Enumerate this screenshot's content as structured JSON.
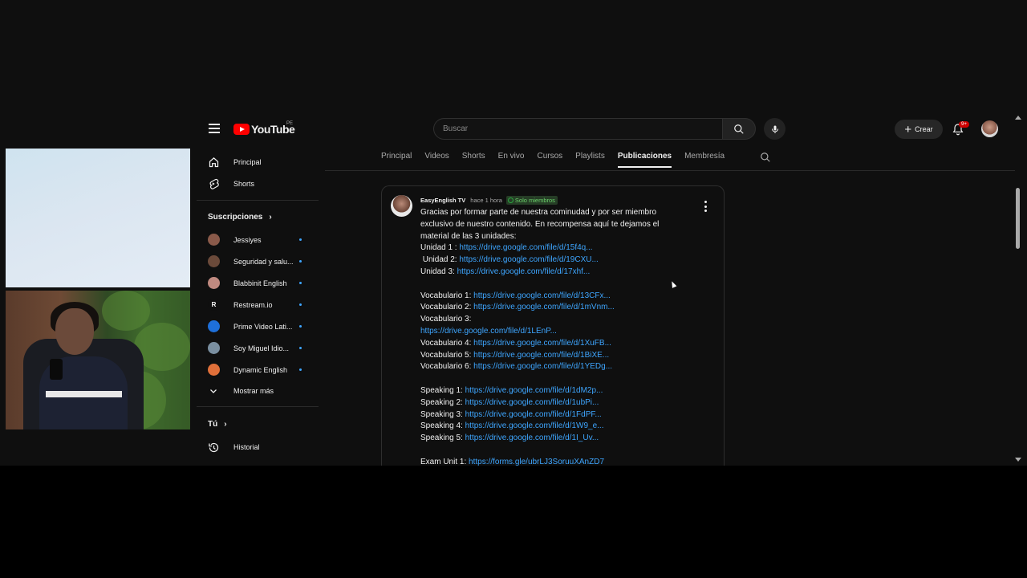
{
  "header": {
    "logo_text": "YouTube",
    "region": "PE",
    "search_placeholder": "Buscar",
    "create_label": "Crear",
    "notifications_badge": "9+"
  },
  "sidebar": {
    "main_items": [
      {
        "label": "Principal",
        "icon": "home-icon"
      },
      {
        "label": "Shorts",
        "icon": "shorts-icon"
      }
    ],
    "subscriptions_title": "Suscripciones",
    "subscriptions": [
      {
        "label": "Jessiyes",
        "avatar_color": "#8a5a4a"
      },
      {
        "label": "Seguridad y salu...",
        "avatar_color": "#6b4a3a"
      },
      {
        "label": "Blabbinit English",
        "avatar_color": "#c08a80"
      },
      {
        "label": "Restream.io",
        "avatar_color": "#0f0f0f",
        "letter": "R"
      },
      {
        "label": "Prime Video Lati...",
        "avatar_color": "#1e6fd9"
      },
      {
        "label": "Soy Miguel Idio...",
        "avatar_color": "#7a8fa0"
      },
      {
        "label": "Dynamic English",
        "avatar_color": "#e0703a"
      }
    ],
    "show_more": "Mostrar más",
    "you_title": "Tú",
    "history": "Historial"
  },
  "tabs": [
    "Principal",
    "Videos",
    "Shorts",
    "En vivo",
    "Cursos",
    "Playlists",
    "Publicaciones",
    "Membresía"
  ],
  "active_tab": "Publicaciones",
  "post": {
    "channel": "EasyEnglish TV",
    "time": "hace 1 hora",
    "badge": "Solo miembros",
    "lines": [
      {
        "text": "Gracias por formar parte de nuestra cominudad y por ser miembro",
        "link": ""
      },
      {
        "text": "exclusivo de nuestro contenido. En recompensa aquí te dejamos el",
        "link": ""
      },
      {
        "text": "material de las 3 unidades:",
        "link": ""
      },
      {
        "text": "Unidad 1 : ",
        "link": "https://drive.google.com/file/d/15f4q..."
      },
      {
        "text": " Unidad 2: ",
        "link": "https://drive.google.com/file/d/19CXU..."
      },
      {
        "text": "Unidad 3: ",
        "link": "https://drive.google.com/file/d/17xhf..."
      },
      {
        "text": "",
        "link": ""
      },
      {
        "text": "Vocabulario 1: ",
        "link": "https://drive.google.com/file/d/13CFx..."
      },
      {
        "text": "Vocabulario 2: ",
        "link": "https://drive.google.com/file/d/1mVnm..."
      },
      {
        "text": "Vocabulario 3:",
        "link": ""
      },
      {
        "text": "",
        "link": "https://drive.google.com/file/d/1LEnP..."
      },
      {
        "text": "Vocabulario 4: ",
        "link": "https://drive.google.com/file/d/1XuFB..."
      },
      {
        "text": "Vocabulario 5: ",
        "link": "https://drive.google.com/file/d/1BiXE..."
      },
      {
        "text": "Vocabulario 6: ",
        "link": "https://drive.google.com/file/d/1YEDg..."
      },
      {
        "text": "",
        "link": ""
      },
      {
        "text": "Speaking 1: ",
        "link": "https://drive.google.com/file/d/1dM2p..."
      },
      {
        "text": "Speaking 2: ",
        "link": "https://drive.google.com/file/d/1ubPi..."
      },
      {
        "text": "Speaking 3: ",
        "link": "https://drive.google.com/file/d/1FdPF..."
      },
      {
        "text": "Speaking 4: ",
        "link": "https://drive.google.com/file/d/1W9_e..."
      },
      {
        "text": "Speaking 5: ",
        "link": "https://drive.google.com/file/d/1I_Uv..."
      },
      {
        "text": "",
        "link": ""
      },
      {
        "text": "Exam Unit 1: ",
        "link": "https://forms.gle/ubrLJ3SoruuXAnZD7"
      }
    ]
  },
  "colors": {
    "background": "#0f0f0f",
    "link": "#3ea6ff",
    "brand_red": "#ff0000",
    "members_green": "#2ba640"
  }
}
